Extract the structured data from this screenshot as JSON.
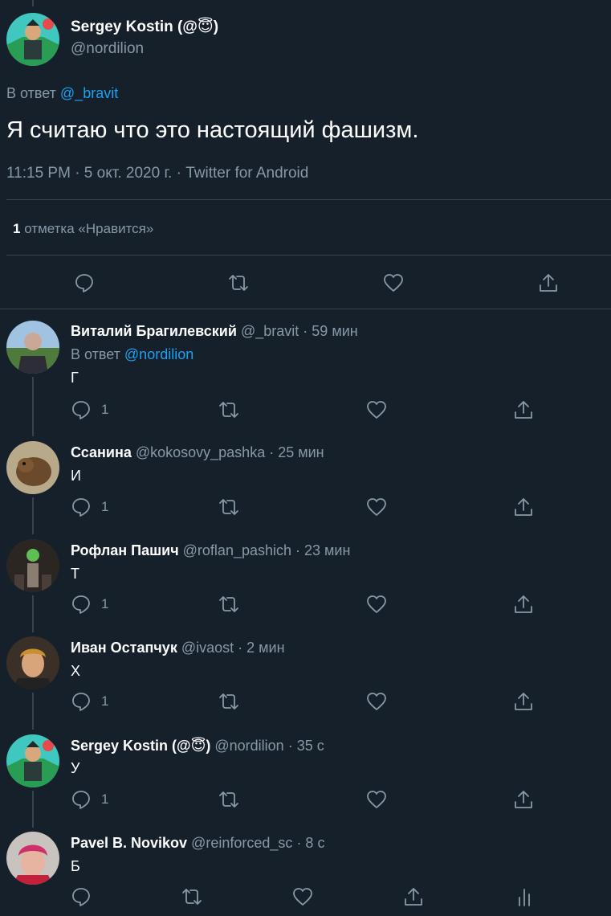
{
  "main_tweet": {
    "author_name": "Sergey Kostin (@",
    "author_emoji": "😇",
    "author_name_close": ")",
    "handle": "@nordilion",
    "reply_prefix": "В ответ",
    "reply_to": "@_bravit",
    "text": "Я считаю что это настоящий фашизм.",
    "meta": "11:15 PM · 5 окт. 2020 г. · Twitter for Android",
    "likes_count": "1",
    "likes_label": "отметка «Нравится»"
  },
  "replies": [
    {
      "name": "Виталий Брагилевский",
      "handle": "@_bravit",
      "time": "· 59 мин",
      "reply_prefix": "В ответ",
      "reply_to": "@nordilion",
      "text": "Г",
      "reply_count": "1"
    },
    {
      "name": "Ссанина",
      "handle": "@kokosovy_pashka",
      "time": "· 25 мин",
      "text": "И",
      "reply_count": "1"
    },
    {
      "name": "Рофлан Пашич",
      "handle": "@roflan_pashich",
      "time": "· 23 мин",
      "text": "Т",
      "reply_count": "1"
    },
    {
      "name": "Иван Остапчук",
      "handle": "@ivaost",
      "time": "· 2 мин",
      "text": "Х",
      "reply_count": "1"
    },
    {
      "name": "Sergey Kostin (@",
      "emoji": "😇",
      "name_close": ")",
      "handle": "@nordilion",
      "time": "· 35 с",
      "text": "У",
      "reply_count": "1"
    },
    {
      "name": "Pavel B. Novikov",
      "handle": "@reinforced_sc",
      "time": "· 8 с",
      "text": "Б"
    }
  ],
  "icons": [
    "reply-icon",
    "retweet-icon",
    "like-icon",
    "share-icon",
    "analytics-icon"
  ],
  "colors": {
    "background": "#15202b",
    "muted": "#8899a6",
    "link": "#1da1f2",
    "divider": "#38444d"
  }
}
